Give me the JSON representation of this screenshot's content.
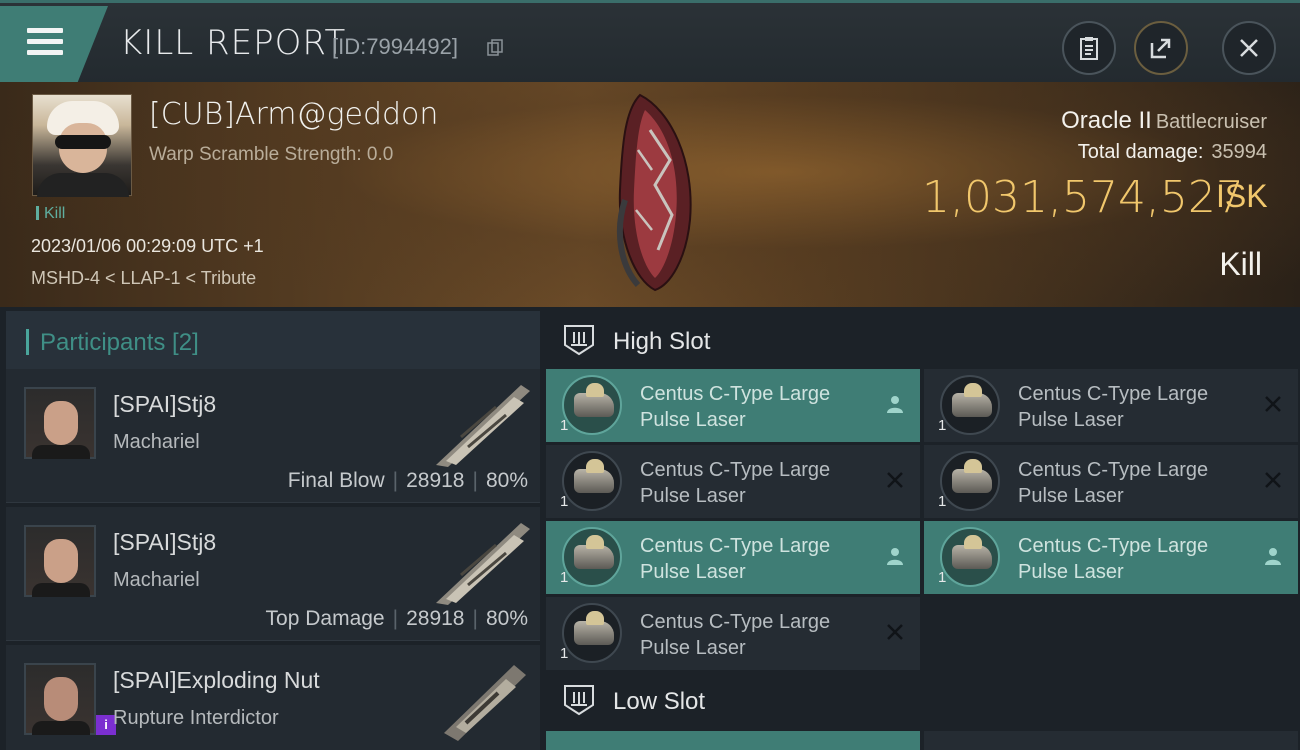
{
  "header": {
    "title": "KILL REPORT",
    "report_id": "[ID:7994492]"
  },
  "victim": {
    "name": "[CUB]Arm@geddon",
    "warp_scramble": "Warp Scramble Strength: 0.0",
    "tag": "Kill",
    "datetime": "2023/01/06 00:29:09 UTC +1",
    "location": "MSHD-4 < LLAP-1 < Tribute",
    "ship_name": "Oracle II",
    "ship_class": "Battlecruiser",
    "total_damage_label": "Total damage:",
    "total_damage_value": "35994",
    "isk_value": "1,031,574,527",
    "isk_unit": "ISK",
    "result": "Kill"
  },
  "participants": {
    "title": "Participants [2]",
    "rows": [
      {
        "name": "[SPAI]Stj8",
        "ship": "Machariel",
        "role": "Final Blow",
        "damage": "28918",
        "percent": "80%"
      },
      {
        "name": "[SPAI]Stj8",
        "ship": "Machariel",
        "role": "Top Damage",
        "damage": "28918",
        "percent": "80%"
      },
      {
        "name": "[SPAI]Exploding Nut",
        "ship": "Rupture Interdictor",
        "role": "",
        "damage": "",
        "percent": ""
      }
    ]
  },
  "slots": {
    "high_title": "High Slot",
    "low_title": "Low Slot",
    "high_modules": [
      {
        "line1": "Centus C-Type Large",
        "line2": "Pulse Laser",
        "qty": "1",
        "status": "person-icon",
        "active": true
      },
      {
        "line1": "Centus C-Type Large",
        "line2": "Pulse Laser",
        "qty": "1",
        "status": "x-icon",
        "active": false
      },
      {
        "line1": "Centus C-Type Large",
        "line2": "Pulse Laser",
        "qty": "1",
        "status": "x-icon",
        "active": false
      },
      {
        "line1": "Centus C-Type Large",
        "line2": "Pulse Laser",
        "qty": "1",
        "status": "x-icon",
        "active": false
      },
      {
        "line1": "Centus C-Type Large",
        "line2": "Pulse Laser",
        "qty": "1",
        "status": "person-icon",
        "active": true
      },
      {
        "line1": "Centus C-Type Large",
        "line2": "Pulse Laser",
        "qty": "1",
        "status": "person-icon",
        "active": true
      },
      {
        "line1": "Centus C-Type Large",
        "line2": "Pulse Laser",
        "qty": "1",
        "status": "x-icon",
        "active": false
      }
    ]
  },
  "colors": {
    "accent": "#3f7d75",
    "isk": "#f1c76c",
    "background": "#1c2228"
  }
}
